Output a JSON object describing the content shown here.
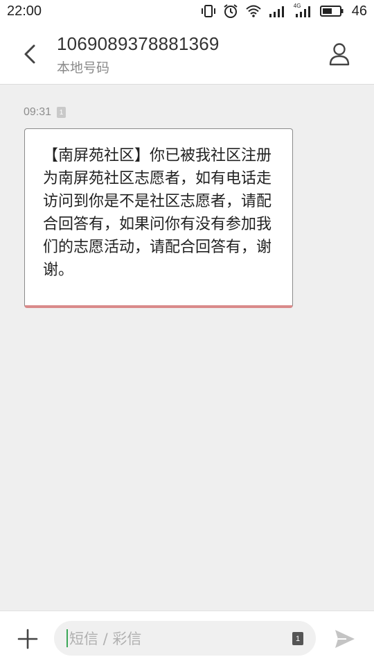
{
  "status_bar": {
    "time": "22:00",
    "network_label": "4G",
    "battery_level": "46"
  },
  "header": {
    "title": "1069089378881369",
    "subtitle": "本地号码",
    "back_icon": "back-arrow",
    "contact_icon": "person-outline"
  },
  "conversation": {
    "messages": [
      {
        "time": "09:31",
        "sim": "1",
        "text": "【南屏苑社区】你已被我社区注册为南屏苑社区志愿者，如有电话走访问到你是不是社区志愿者，请配合回答有，如果问你有没有参加我们的志愿活动，请配合回答有，谢谢。"
      }
    ]
  },
  "composer": {
    "placeholder": "短信 / 彩信",
    "sim": "1",
    "add_icon": "plus",
    "send_icon": "send-arrow"
  },
  "colors": {
    "accent_cursor": "#3aa757",
    "bubble_bottom": "#d98a8a",
    "background": "#efefef"
  }
}
